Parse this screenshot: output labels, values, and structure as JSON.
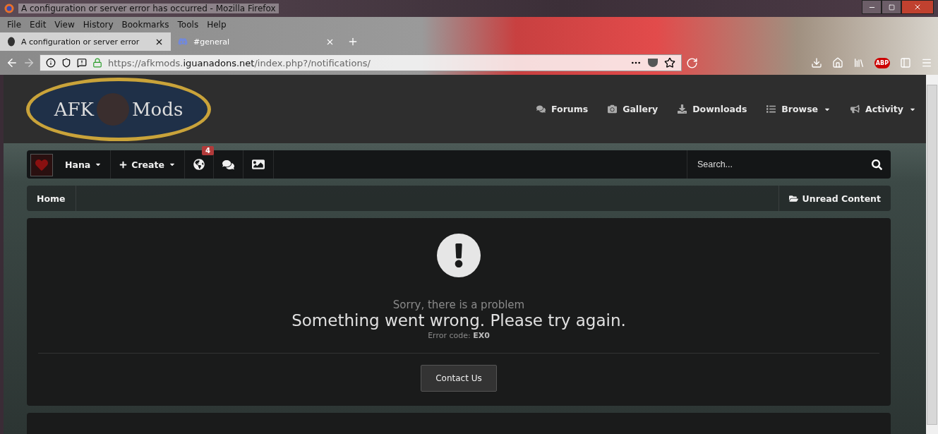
{
  "window": {
    "title": "A configuration or server error has occurred - Mozilla Firefox"
  },
  "menu": [
    "File",
    "Edit",
    "View",
    "History",
    "Bookmarks",
    "Tools",
    "Help"
  ],
  "tabs": [
    {
      "label": "A configuration or server error",
      "selected": true
    },
    {
      "label": "#general",
      "selected": false
    }
  ],
  "address": {
    "url_parts": [
      {
        "text": "https://afkmods.",
        "emphasized": false
      },
      {
        "text": "iguanadons.net",
        "emphasized": true
      },
      {
        "text": "/index.php?/notifications/",
        "emphasized": false
      }
    ]
  },
  "toolbar": {
    "adblock_label": "ABP"
  },
  "site": {
    "logo": {
      "left": "AFK",
      "right": "Mods"
    },
    "nav": [
      {
        "label": "Forums",
        "dropdown": false
      },
      {
        "label": "Gallery",
        "dropdown": false
      },
      {
        "label": "Downloads",
        "dropdown": false
      },
      {
        "label": "Browse",
        "dropdown": true
      },
      {
        "label": "Activity",
        "dropdown": true
      }
    ],
    "userbar": {
      "user": "Hana",
      "create": "Create",
      "notification_count": "4",
      "search": {
        "placeholder": "Search..."
      }
    },
    "breadcrumb": {
      "home": "Home",
      "unread": "Unread Content"
    },
    "error": {
      "subtitle": "Sorry, there is a problem",
      "message": "Something went wrong. Please try again.",
      "code_label": "Error code:",
      "code": "EX0",
      "button": "Contact Us"
    }
  }
}
